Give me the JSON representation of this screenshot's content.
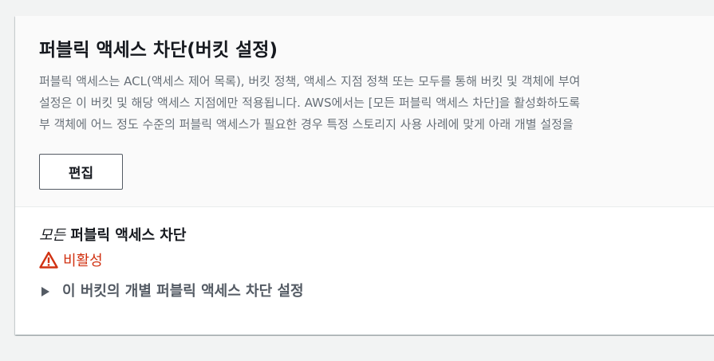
{
  "header": {
    "title": "퍼블릭 액세스 차단(버킷 설정)",
    "description_lines": [
      "퍼블릭 액세스는 ACL(액세스 제어 목록), 버킷 정책, 액세스 지점 정책 또는 모두를 통해 버킷 및 객체에 부여",
      "설정은 이 버킷 및 해당 액세스 지점에만 적용됩니다. AWS에서는 [모든 퍼블릭 액세스 차단]을 활성화하도록",
      "부 객체에 어느 정도 수준의 퍼블릭 액세스가 필요한 경우 특정 스토리지 사용 사례에 맞게 아래 개별 설정을"
    ],
    "edit_button_label": "편집"
  },
  "block_all": {
    "label_emphasis": "모든",
    "label_rest": " 퍼블릭 액세스 차단",
    "status_icon": "warning-icon",
    "status_text": "비활성",
    "status_color": "#d13212"
  },
  "expander": {
    "icon": "caret-right-icon",
    "label": "이 버킷의 개별 퍼블릭 액세스 차단 설정"
  }
}
